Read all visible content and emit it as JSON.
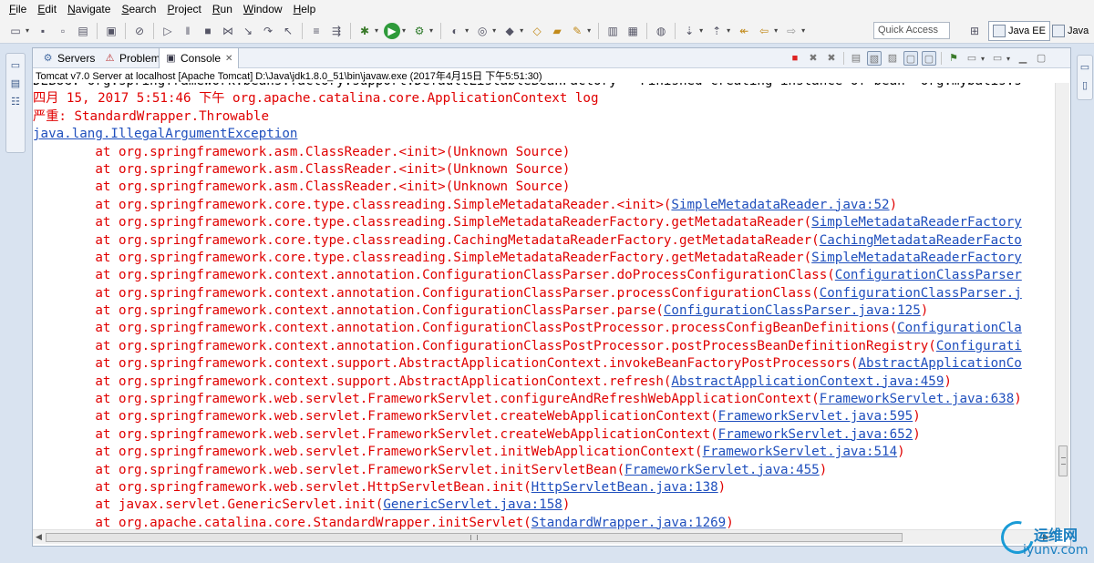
{
  "menubar": {
    "items": [
      {
        "mnemonic": "F",
        "rest": "ile"
      },
      {
        "mnemonic": "E",
        "rest": "dit"
      },
      {
        "mnemonic": "N",
        "rest": "avigate"
      },
      {
        "mnemonic": "S",
        "rest": "earch"
      },
      {
        "mnemonic": "P",
        "rest": "roject"
      },
      {
        "mnemonic": "R",
        "rest": "un"
      },
      {
        "mnemonic": "W",
        "rest": "indow"
      },
      {
        "mnemonic": "H",
        "rest": "elp"
      }
    ]
  },
  "toolbar": {
    "quick_access_placeholder": "Quick Access",
    "perspective_javaee": "Java EE",
    "perspective_java": "Java"
  },
  "view": {
    "tabs": [
      {
        "label": "Servers"
      },
      {
        "label": "Problems"
      },
      {
        "label": "Console"
      }
    ],
    "console_header": "Tomcat v7.0 Server at localhost [Apache Tomcat] D:\\Java\\jdk1.8.0_51\\bin\\javaw.exe (2017年4月15日 下午5:51:30)"
  },
  "console": {
    "first_line": "DEBUG: org.springframework.beans.factory.support.DefaultListableBeanFactory - Finished creating instance of bean  org.mybatis.s",
    "log_line": "四月 15, 2017 5:51:46 下午 org.apache.catalina.core.ApplicationContext log",
    "severe_line": "严重: StandardWrapper.Throwable",
    "exception": "java.lang.IllegalArgumentException",
    "stack": [
      {
        "text": "        at org.springframework.asm.ClassReader.<init>(Unknown Source)",
        "link": ""
      },
      {
        "text": "        at org.springframework.asm.ClassReader.<init>(Unknown Source)",
        "link": ""
      },
      {
        "text": "        at org.springframework.asm.ClassReader.<init>(Unknown Source)",
        "link": ""
      },
      {
        "text": "        at org.springframework.core.type.classreading.SimpleMetadataReader.<init>(",
        "link": "SimpleMetadataReader.java:52",
        "tail": ")"
      },
      {
        "text": "        at org.springframework.core.type.classreading.SimpleMetadataReaderFactory.getMetadataReader(",
        "link": "SimpleMetadataReaderFactory",
        "tail": ""
      },
      {
        "text": "        at org.springframework.core.type.classreading.CachingMetadataReaderFactory.getMetadataReader(",
        "link": "CachingMetadataReaderFacto",
        "tail": ""
      },
      {
        "text": "        at org.springframework.core.type.classreading.SimpleMetadataReaderFactory.getMetadataReader(",
        "link": "SimpleMetadataReaderFactory",
        "tail": ""
      },
      {
        "text": "        at org.springframework.context.annotation.ConfigurationClassParser.doProcessConfigurationClass(",
        "link": "ConfigurationClassParser",
        "tail": ""
      },
      {
        "text": "        at org.springframework.context.annotation.ConfigurationClassParser.processConfigurationClass(",
        "link": "ConfigurationClassParser.j",
        "tail": ""
      },
      {
        "text": "        at org.springframework.context.annotation.ConfigurationClassParser.parse(",
        "link": "ConfigurationClassParser.java:125",
        "tail": ")"
      },
      {
        "text": "        at org.springframework.context.annotation.ConfigurationClassPostProcessor.processConfigBeanDefinitions(",
        "link": "ConfigurationCla",
        "tail": ""
      },
      {
        "text": "        at org.springframework.context.annotation.ConfigurationClassPostProcessor.postProcessBeanDefinitionRegistry(",
        "link": "Configurati",
        "tail": ""
      },
      {
        "text": "        at org.springframework.context.support.AbstractApplicationContext.invokeBeanFactoryPostProcessors(",
        "link": "AbstractApplicationCo",
        "tail": ""
      },
      {
        "text": "        at org.springframework.context.support.AbstractApplicationContext.refresh(",
        "link": "AbstractApplicationContext.java:459",
        "tail": ")"
      },
      {
        "text": "        at org.springframework.web.servlet.FrameworkServlet.configureAndRefreshWebApplicationContext(",
        "link": "FrameworkServlet.java:638",
        "tail": ")"
      },
      {
        "text": "        at org.springframework.web.servlet.FrameworkServlet.createWebApplicationContext(",
        "link": "FrameworkServlet.java:595",
        "tail": ")"
      },
      {
        "text": "        at org.springframework.web.servlet.FrameworkServlet.createWebApplicationContext(",
        "link": "FrameworkServlet.java:652",
        "tail": ")"
      },
      {
        "text": "        at org.springframework.web.servlet.FrameworkServlet.initWebApplicationContext(",
        "link": "FrameworkServlet.java:514",
        "tail": ")"
      },
      {
        "text": "        at org.springframework.web.servlet.FrameworkServlet.initServletBean(",
        "link": "FrameworkServlet.java:455",
        "tail": ")"
      },
      {
        "text": "        at org.springframework.web.servlet.HttpServletBean.init(",
        "link": "HttpServletBean.java:138",
        "tail": ")"
      },
      {
        "text": "        at javax.servlet.GenericServlet.init(",
        "link": "GenericServlet.java:158",
        "tail": ")"
      },
      {
        "text": "        at org.apache.catalina.core.StandardWrapper.initServlet(",
        "link": "StandardWrapper.java:1269",
        "tail": ")"
      }
    ]
  },
  "watermark": {
    "name": "运维网",
    "url": "iyunv.com"
  },
  "colors": {
    "stderr": "#e00000",
    "link": "#1f4fbd",
    "stdout": "#000000"
  }
}
